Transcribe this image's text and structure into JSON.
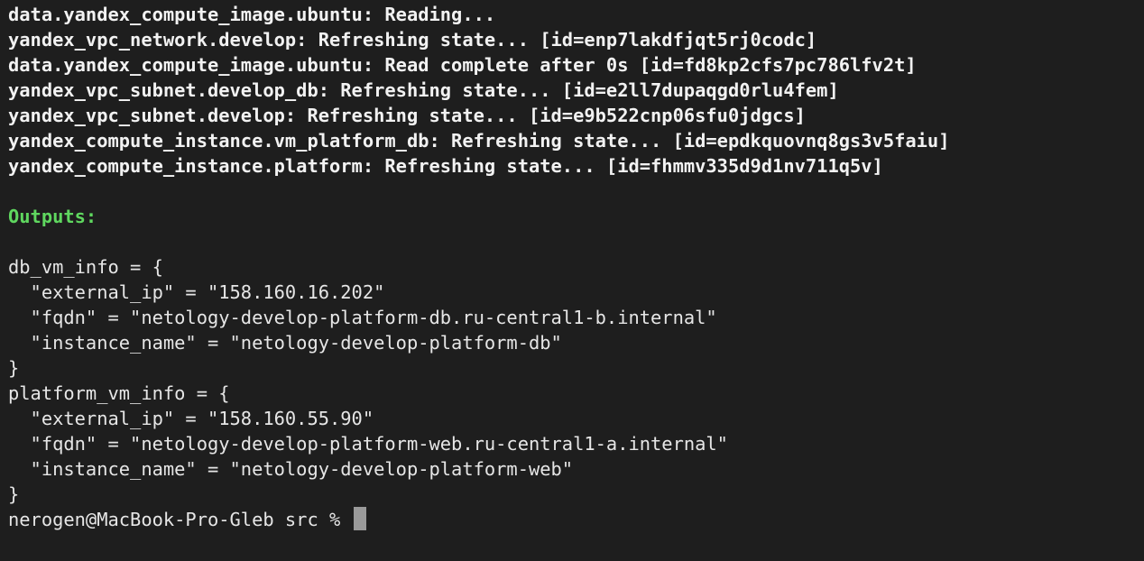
{
  "terminal": {
    "refresh_lines": [
      "data.yandex_compute_image.ubuntu: Reading...",
      "yandex_vpc_network.develop: Refreshing state... [id=enp7lakdfjqt5rj0codc]",
      "data.yandex_compute_image.ubuntu: Read complete after 0s [id=fd8kp2cfs7pc786lfv2t]",
      "yandex_vpc_subnet.develop_db: Refreshing state... [id=e2ll7dupaqgd0rlu4fem]",
      "yandex_vpc_subnet.develop: Refreshing state... [id=e9b522cnp06sfu0jdgcs]",
      "yandex_compute_instance.vm_platform_db: Refreshing state... [id=epdkquovnq8gs3v5faiu]",
      "yandex_compute_instance.platform: Refreshing state... [id=fhmmv335d9d1nv711q5v]"
    ],
    "outputs_header": "Outputs:",
    "output_lines": [
      "db_vm_info = {",
      "  \"external_ip\" = \"158.160.16.202\"",
      "  \"fqdn\" = \"netology-develop-platform-db.ru-central1-b.internal\"",
      "  \"instance_name\" = \"netology-develop-platform-db\"",
      "}",
      "platform_vm_info = {",
      "  \"external_ip\" = \"158.160.55.90\"",
      "  \"fqdn\" = \"netology-develop-platform-web.ru-central1-a.internal\"",
      "  \"instance_name\" = \"netology-develop-platform-web\"",
      "}"
    ],
    "prompt": "nerogen@MacBook-Pro-Gleb src % "
  },
  "colors": {
    "background": "#1e1e1e",
    "text": "#e6e6e6",
    "outputs_header": "#5fd75f",
    "cursor": "#9a9a9a"
  }
}
